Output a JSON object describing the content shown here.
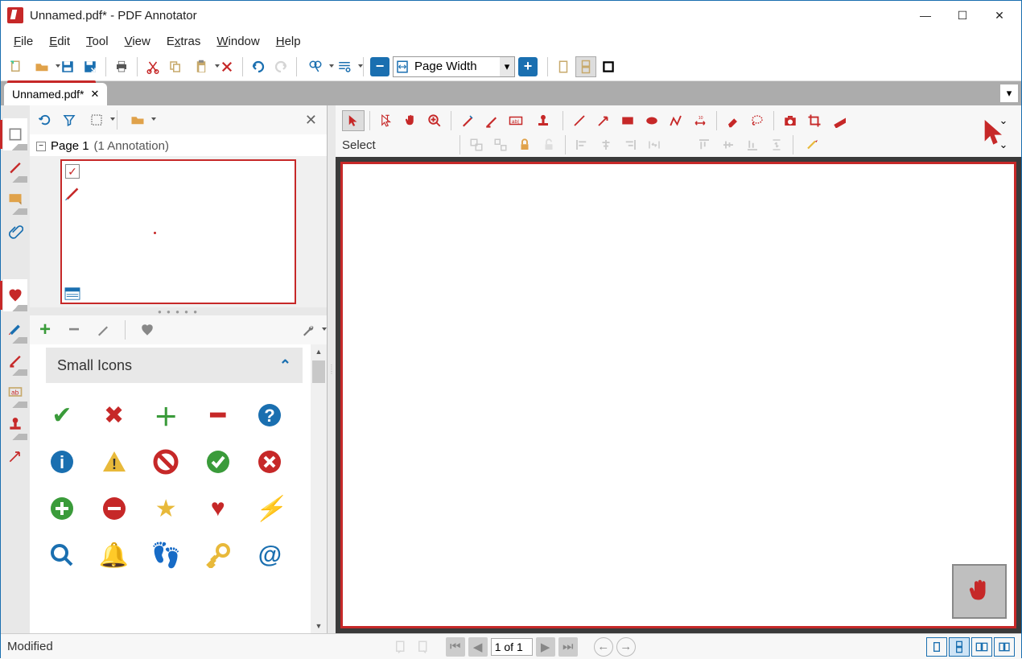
{
  "title": "Unnamed.pdf* - PDF Annotator",
  "menus": [
    "File",
    "Edit",
    "Tool",
    "View",
    "Extras",
    "Window",
    "Help"
  ],
  "zoom_mode": "Page Width",
  "tab_label": "Unnamed.pdf*",
  "page_label": "Page 1",
  "annotation_count": "(1 Annotation)",
  "section_title": "Small Icons",
  "select_label": "Select",
  "status_text": "Modified",
  "page_of": "1 of 1",
  "colors": {
    "accent": "#c62828",
    "blue": "#1a6fb0"
  }
}
